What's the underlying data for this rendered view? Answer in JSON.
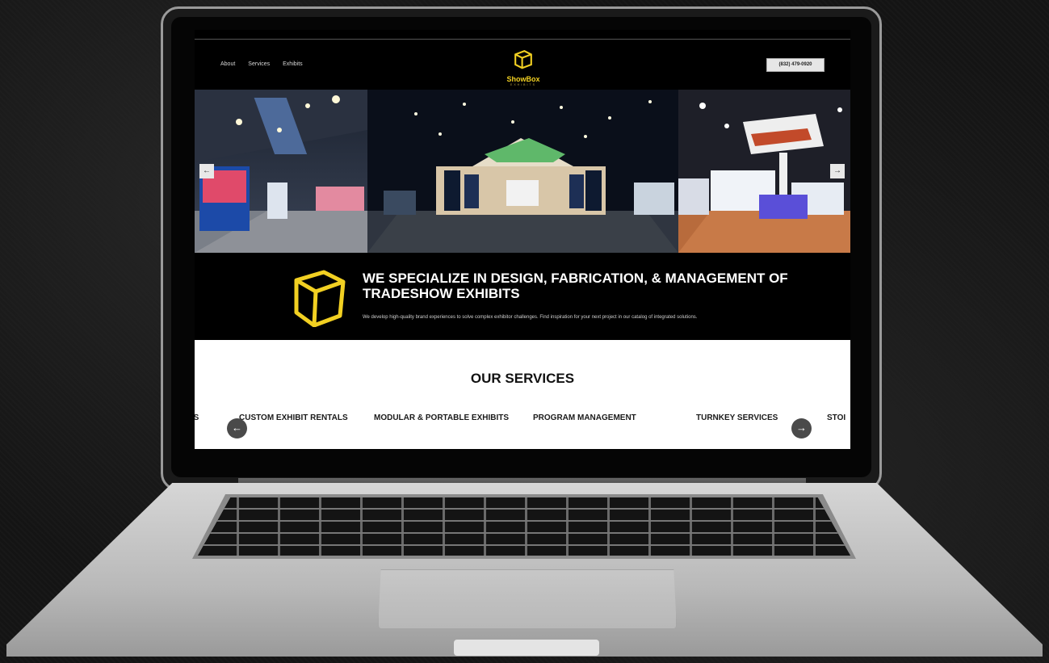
{
  "nav": {
    "items": [
      "About",
      "Services",
      "Exhibits"
    ]
  },
  "logo": {
    "name": "ShowBox",
    "sub": "EXHIBITS"
  },
  "phone": "(832) 479-0920",
  "hero": {
    "prev": "←",
    "next": "→"
  },
  "intro": {
    "headline": "WE SPECIALIZE IN DESIGN, FABRICATION, & MANAGEMENT OF TRADESHOW EXHIBITS",
    "description": "We develop high-quality brand experiences to solve complex exhibitor challenges. Find inspiration for your next project in our catalog of integrated solutions."
  },
  "services": {
    "title": "OUR SERVICES",
    "items": [
      "ES",
      "CUSTOM EXHIBIT RENTALS",
      "MODULAR & PORTABLE EXHIBITS",
      "PROGRAM MANAGEMENT",
      "TURNKEY SERVICES",
      "STOI"
    ],
    "prev": "←",
    "next": "→"
  },
  "colors": {
    "accent": "#f2d022",
    "background": "#000000"
  }
}
